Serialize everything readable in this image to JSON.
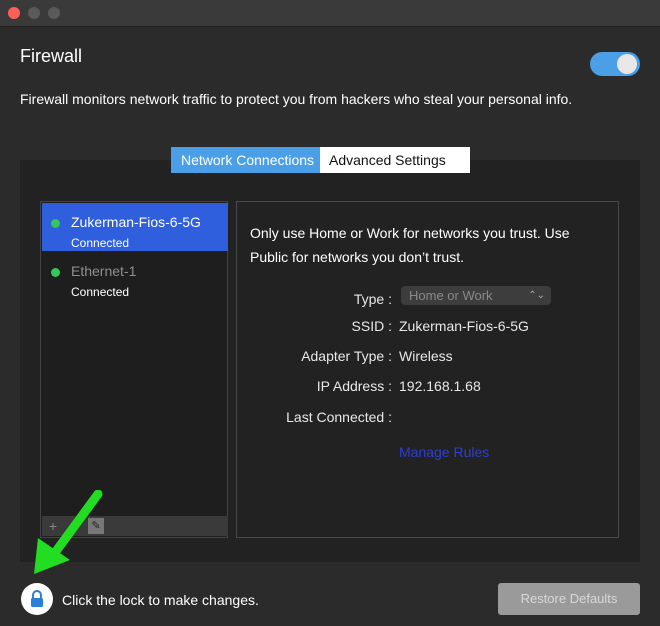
{
  "window": {
    "title": "Firewall",
    "description": "Firewall monitors network traffic to protect you from hackers who steal your personal info.",
    "firewall_enabled": true
  },
  "tabs": [
    {
      "label": "Network Connections",
      "active": true
    },
    {
      "label": "Advanced Settings",
      "active": false
    }
  ],
  "networks": [
    {
      "name": "Zukerman-Fios-6-5G",
      "status": "Connected",
      "selected": true
    },
    {
      "name": "Ethernet-1",
      "status": "Connected",
      "selected": false
    }
  ],
  "list_toolbar": {
    "add_icon": "plus-icon",
    "edit_icon": "pencil-icon"
  },
  "detail": {
    "info": "Only use Home or Work for networks you trust. Use Public for networks you don’t trust.",
    "type_label": "Type :",
    "type_value": "Home or Work",
    "ssid_label": "SSID :",
    "ssid_value": "Zukerman-Fios-6-5G",
    "adapter_label": "Adapter Type :",
    "adapter_value": "Wireless",
    "ip_label": "IP Address :",
    "ip_value": "192.168.1.68",
    "last_label": "Last Connected :",
    "last_value": "",
    "manage_rules": "Manage Rules"
  },
  "footer": {
    "lock_text": "Click the lock to make changes.",
    "restore_label": "Restore Defaults"
  },
  "colors": {
    "accent": "#4a9fe6",
    "selection": "#2f5fdc",
    "connected": "#34c759",
    "annotation_arrow": "#22dd22"
  }
}
